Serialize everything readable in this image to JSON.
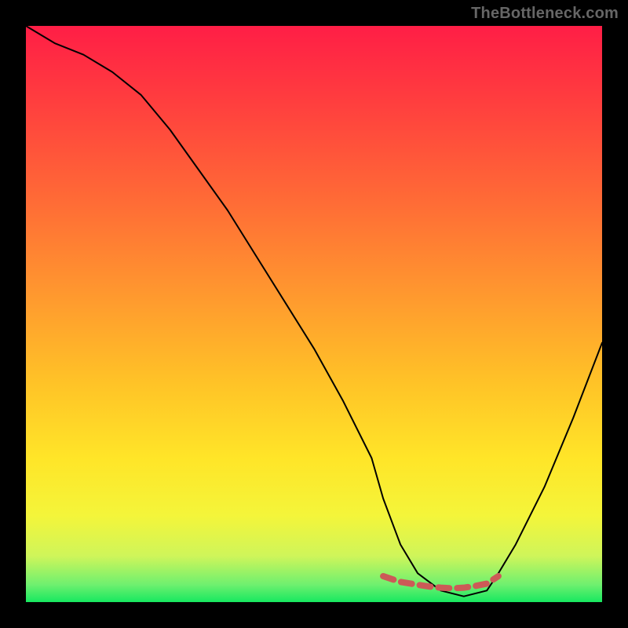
{
  "watermark": "TheBottleneck.com",
  "chart_data": {
    "type": "line",
    "title": "",
    "xlabel": "",
    "ylabel": "",
    "xlim": [
      0,
      100
    ],
    "ylim": [
      0,
      100
    ],
    "series": [
      {
        "name": "bottleneck-curve",
        "x": [
          0,
          5,
          10,
          15,
          20,
          25,
          30,
          35,
          40,
          45,
          50,
          55,
          60,
          62,
          65,
          68,
          72,
          76,
          80,
          82,
          85,
          90,
          95,
          100
        ],
        "y": [
          100,
          97,
          95,
          92,
          88,
          82,
          75,
          68,
          60,
          52,
          44,
          35,
          25,
          18,
          10,
          5,
          2,
          1,
          2,
          5,
          10,
          20,
          32,
          45
        ]
      }
    ],
    "highlight": {
      "name": "optimal-range",
      "x": [
        62,
        65,
        68,
        70,
        72,
        74,
        76,
        78,
        80,
        82
      ],
      "y": [
        4.5,
        3.5,
        3.0,
        2.7,
        2.5,
        2.4,
        2.5,
        2.8,
        3.2,
        4.5
      ],
      "color": "#cc5a57"
    },
    "background_gradient": {
      "stops": [
        {
          "offset": 0.0,
          "color": "#ff1e46"
        },
        {
          "offset": 0.12,
          "color": "#ff3b3f"
        },
        {
          "offset": 0.3,
          "color": "#ff6a36"
        },
        {
          "offset": 0.48,
          "color": "#ff9c2e"
        },
        {
          "offset": 0.62,
          "color": "#ffc327"
        },
        {
          "offset": 0.75,
          "color": "#ffe528"
        },
        {
          "offset": 0.85,
          "color": "#f4f53a"
        },
        {
          "offset": 0.92,
          "color": "#cff55a"
        },
        {
          "offset": 0.97,
          "color": "#6ef06f"
        },
        {
          "offset": 1.0,
          "color": "#17e860"
        }
      ]
    }
  }
}
